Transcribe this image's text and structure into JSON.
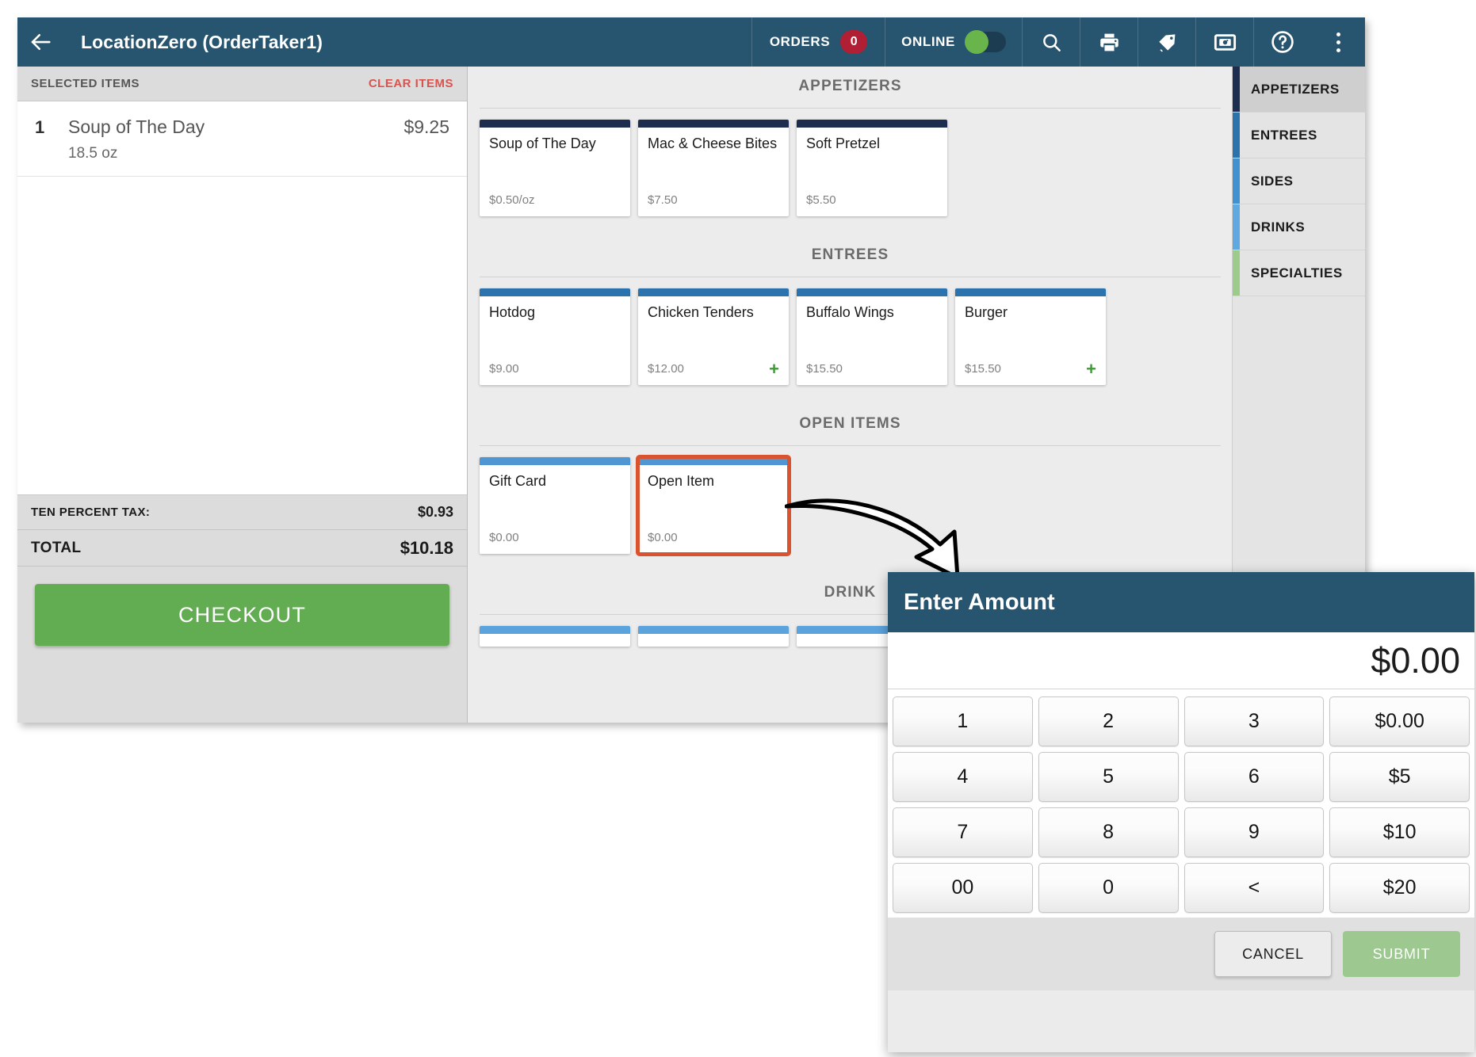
{
  "header": {
    "back_icon": "arrow-left-icon",
    "title": "LocationZero (OrderTaker1)",
    "orders_label": "ORDERS",
    "orders_count": "0",
    "online_label": "ONLINE",
    "online_state": "on",
    "icons": [
      "search-icon",
      "print-icon",
      "tag-icon",
      "camera-icon",
      "help-icon",
      "overflow-menu-icon"
    ],
    "bar_color": "#27546f",
    "badge_color": "#b11f34",
    "toggle_on_color": "#6ab54b"
  },
  "order_panel": {
    "selected_items_label": "SELECTED ITEMS",
    "clear_items_label": "CLEAR ITEMS",
    "clear_items_color": "#d9534f",
    "items": [
      {
        "qty": "1",
        "name": "Soup of The Day",
        "price": "$9.25",
        "detail": "18.5 oz"
      }
    ],
    "tax_label": "TEN PERCENT TAX:",
    "tax_value": "$0.93",
    "total_label": "TOTAL",
    "total_value": "$10.18",
    "checkout_label": "CHECKOUT",
    "checkout_color": "#62ac52"
  },
  "catalog": {
    "sections": [
      {
        "title": "APPETIZERS",
        "accent": "#1d2d4f",
        "items": [
          {
            "name": "Soup of The Day",
            "price": "$0.50/oz",
            "plus": ""
          },
          {
            "name": "Mac & Cheese Bites",
            "price": "$7.50",
            "plus": ""
          },
          {
            "name": "Soft Pretzel",
            "price": "$5.50",
            "plus": ""
          }
        ]
      },
      {
        "title": "ENTREES",
        "accent": "#2c72ad",
        "items": [
          {
            "name": "Hotdog",
            "price": "$9.00",
            "plus": ""
          },
          {
            "name": "Chicken Tenders",
            "price": "$12.00",
            "plus": "+"
          },
          {
            "name": "Buffalo Wings",
            "price": "$15.50",
            "plus": ""
          },
          {
            "name": "Burger",
            "price": "$15.50",
            "plus": "+"
          }
        ]
      },
      {
        "title": "OPEN ITEMS",
        "accent": "#4f96d2",
        "items": [
          {
            "name": "Gift Card",
            "price": "$0.00",
            "plus": ""
          },
          {
            "name": "Open Item",
            "price": "$0.00",
            "plus": "",
            "highlighted": true
          }
        ]
      },
      {
        "title": "DRINK",
        "accent": "#5ba3dd",
        "clipped": true,
        "items": [
          {
            "name": "",
            "price": "",
            "plus": ""
          },
          {
            "name": "",
            "price": "",
            "plus": ""
          },
          {
            "name": "",
            "price": "",
            "plus": ""
          }
        ]
      }
    ],
    "highlight_color": "#d9542e"
  },
  "rail": {
    "items": [
      {
        "label": "APPETIZERS",
        "accent": "#1d2d4f",
        "active": true
      },
      {
        "label": "ENTREES",
        "accent": "#2c72ad",
        "active": false
      },
      {
        "label": "SIDES",
        "accent": "#4190cf",
        "active": false
      },
      {
        "label": "DRINKS",
        "accent": "#5fa8e0",
        "active": false
      },
      {
        "label": "SPECIALTIES",
        "accent": "#9ccb8c",
        "active": false
      }
    ]
  },
  "dialog": {
    "title": "Enter Amount",
    "amount": "$0.00",
    "keys": [
      "1",
      "2",
      "3",
      "$0.00",
      "4",
      "5",
      "6",
      "$5",
      "7",
      "8",
      "9",
      "$10",
      "00",
      "0",
      "<",
      "$20"
    ],
    "cancel_label": "CANCEL",
    "submit_label": "SUBMIT",
    "submit_color": "#9dc88f",
    "header_color": "#27546f"
  }
}
